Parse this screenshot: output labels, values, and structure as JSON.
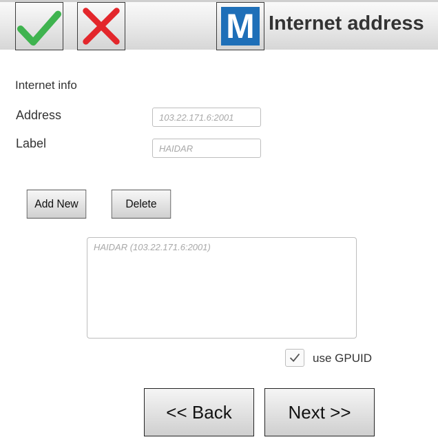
{
  "header": {
    "title": "Internet address",
    "logo_letter": "M",
    "accept_icon": "checkmark-icon",
    "cancel_icon": "cross-icon",
    "logo_icon": "m-logo-icon"
  },
  "form": {
    "section_title": "Internet info",
    "address_label": "Address",
    "address_placeholder": "103.22.171.6:2001",
    "label_label": "Label",
    "label_placeholder": "HAIDAR"
  },
  "buttons": {
    "add_new": "Add New",
    "delete": "Delete",
    "back": "<< Back",
    "next": "Next >>"
  },
  "list": {
    "items": [
      "HAIDAR (103.22.171.6:2001)"
    ]
  },
  "options": {
    "use_gpuid_label": "use GPUID",
    "use_gpuid_checked": true
  },
  "colors": {
    "check_green": "#3fb34f",
    "cross_red": "#e3262b",
    "logo_blue": "#1e6fb8"
  }
}
